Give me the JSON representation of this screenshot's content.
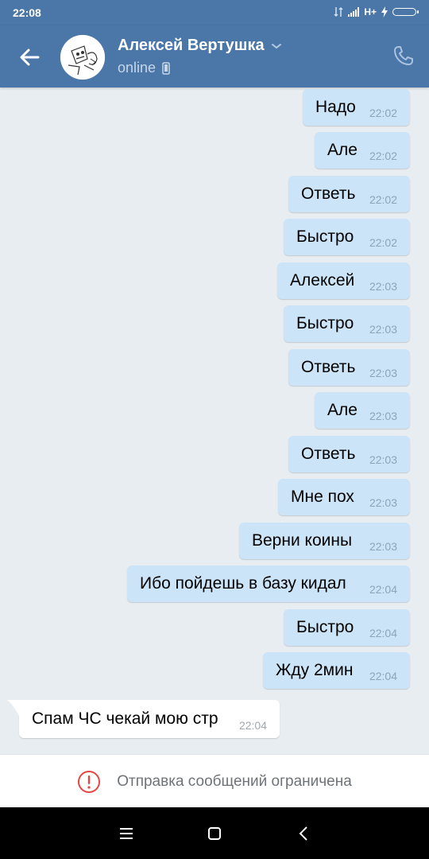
{
  "status_bar": {
    "time": "22:08",
    "network": "H+"
  },
  "header": {
    "contact_name": "Алексей Вертушка",
    "status": "online"
  },
  "messages": [
    {
      "text": "Надо",
      "time": "22:02",
      "dir": "out"
    },
    {
      "text": "Але",
      "time": "22:02",
      "dir": "out"
    },
    {
      "text": "Ответь",
      "time": "22:02",
      "dir": "out"
    },
    {
      "text": "Быстро",
      "time": "22:02",
      "dir": "out"
    },
    {
      "text": "Алексей",
      "time": "22:03",
      "dir": "out"
    },
    {
      "text": "Быстро",
      "time": "22:03",
      "dir": "out"
    },
    {
      "text": "Ответь",
      "time": "22:03",
      "dir": "out"
    },
    {
      "text": "Але",
      "time": "22:03",
      "dir": "out"
    },
    {
      "text": "Ответь",
      "time": "22:03",
      "dir": "out"
    },
    {
      "text": "Мне пох",
      "time": "22:03",
      "dir": "out"
    },
    {
      "text": "Верни коины",
      "time": "22:03",
      "dir": "out"
    },
    {
      "text": "Ибо пойдешь в базу кидал",
      "time": "22:04",
      "dir": "out"
    },
    {
      "text": "Быстро",
      "time": "22:04",
      "dir": "out"
    },
    {
      "text": "Жду 2мин",
      "time": "22:04",
      "dir": "out"
    },
    {
      "text": "Спам ЧС чекай мою стр",
      "time": "22:04",
      "dir": "in"
    }
  ],
  "footer": {
    "restriction_text": "Отправка сообщений ограничена"
  },
  "colors": {
    "header": "#4a76a8",
    "outgoing_bubble": "#cce4f7",
    "incoming_bubble": "#ffffff",
    "chat_bg": "#e8edf2",
    "alert": "#e64646"
  }
}
